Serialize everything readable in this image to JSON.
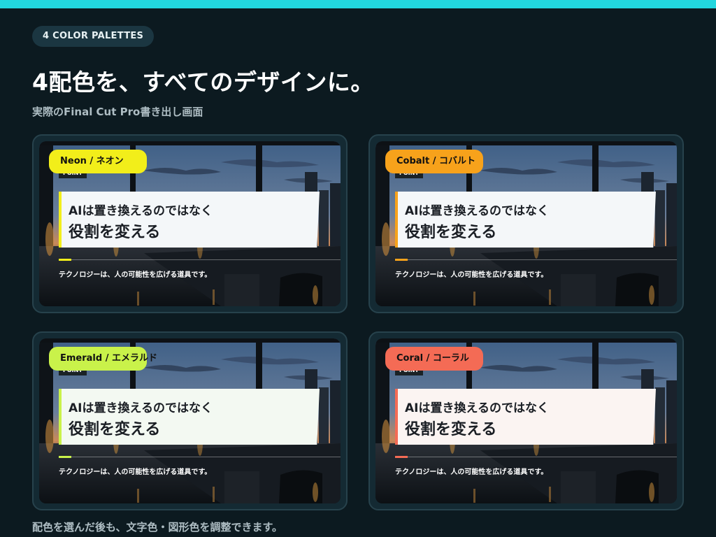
{
  "badge": "4 COLOR PALETTES",
  "headline": "4配色を、すべてのデザインに。",
  "subhead": "実際のFinal Cut Pro書き出し画面",
  "footnote": "配色を選んだ後も、文字色・図形色を調整できます。",
  "accent_color": "#22d6de",
  "cards": [
    {
      "tag": "Neon / ネオン",
      "color": "#f2ee1a",
      "point": "POINT",
      "line1": "AIは置き換えるのではなく",
      "line2": "役割を変える",
      "caption": "テクノロジーは、人の可能性を広げる道具です。",
      "panel_bg": "#f4f7f9"
    },
    {
      "tag": "Cobalt / コバルト",
      "color": "#f7a21b",
      "point": "POINT",
      "line1": "AIは置き換えるのではなく",
      "line2": "役割を変える",
      "caption": "テクノロジーは、人の可能性を広げる道具です。",
      "panel_bg": "#f4f7f9"
    },
    {
      "tag": "Emerald / エメラルド",
      "color": "#c9f24a",
      "point": "POINT",
      "line1": "AIは置き換えるのではなく",
      "line2": "役割を変える",
      "caption": "テクノロジーは、人の可能性を広げる道具です。",
      "panel_bg": "#f3f9f2"
    },
    {
      "tag": "Coral / コーラル",
      "color": "#f46b55",
      "point": "POINT",
      "line1": "AIは置き換えるのではなく",
      "line2": "役割を変える",
      "caption": "テクノロジーは、人の可能性を広げる道具です。",
      "panel_bg": "#fbf4f2"
    }
  ]
}
